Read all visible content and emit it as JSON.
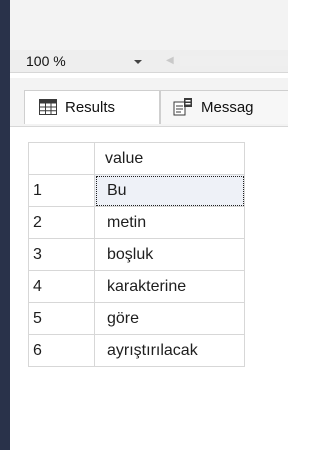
{
  "toolbar": {
    "zoom_value": "100 %"
  },
  "tabs": [
    {
      "label": "Results",
      "icon": "results-grid-icon",
      "active": true
    },
    {
      "label": "Messag",
      "icon": "messages-icon",
      "active": false
    }
  ],
  "grid": {
    "header": {
      "rowno": "",
      "value": "value"
    },
    "rows": [
      {
        "rowno": "1",
        "value": "Bu",
        "selected": true
      },
      {
        "rowno": "2",
        "value": "metin"
      },
      {
        "rowno": "3",
        "value": "boşluk"
      },
      {
        "rowno": "4",
        "value": "karakterine"
      },
      {
        "rowno": "5",
        "value": "göre"
      },
      {
        "rowno": "6",
        "value": "ayrıştırılacak"
      }
    ]
  },
  "colors": {
    "left_strip": "#29324a",
    "selection_bg": "#eef1f7",
    "border": "#d7d7d7"
  }
}
